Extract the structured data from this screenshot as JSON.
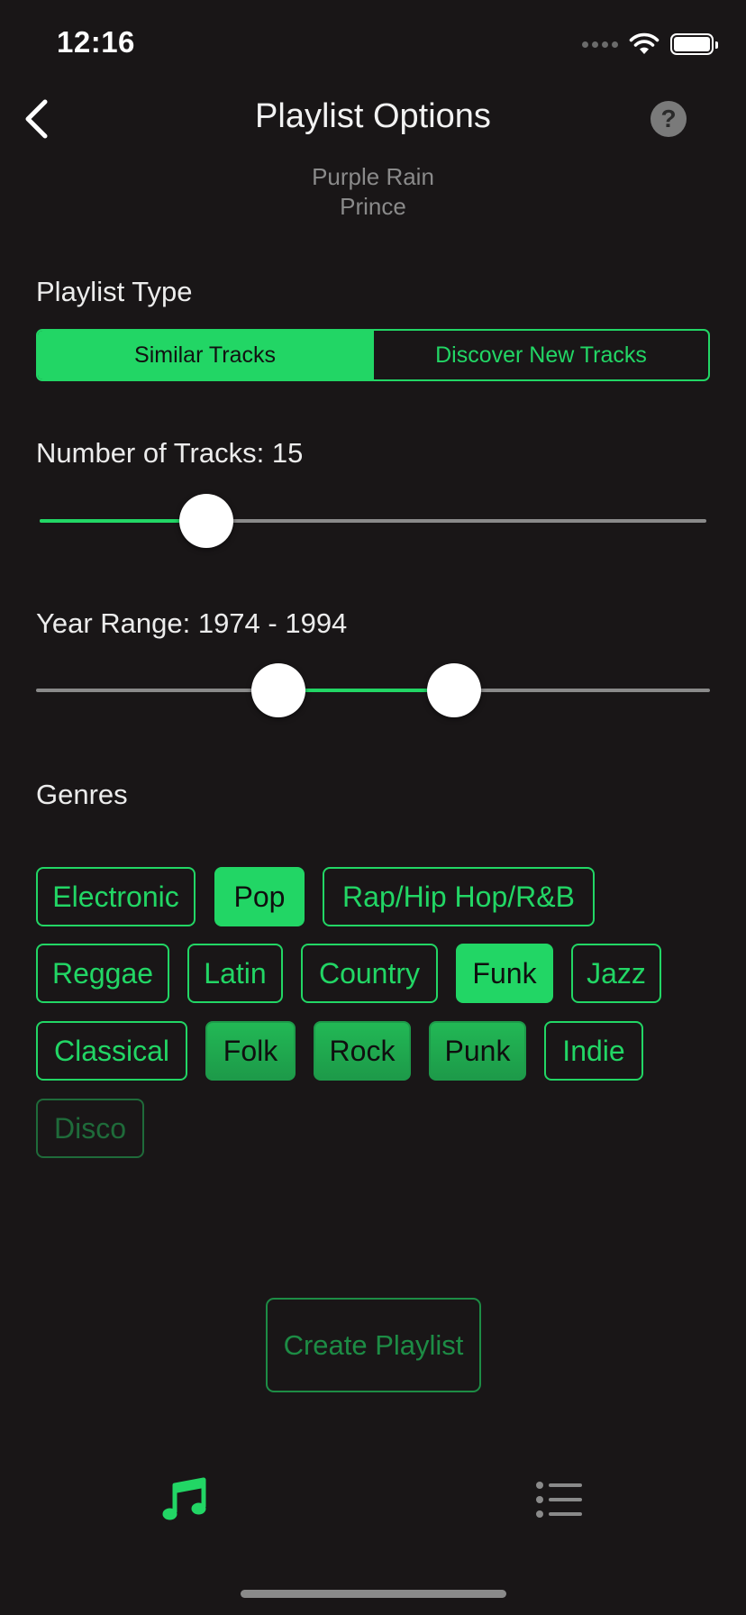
{
  "status_bar": {
    "time": "12:16"
  },
  "nav": {
    "title": "Playlist Options",
    "help_label": "?"
  },
  "song": {
    "title": "Purple Rain",
    "artist": "Prince"
  },
  "playlist_type": {
    "label": "Playlist Type",
    "options": [
      "Similar Tracks",
      "Discover New Tracks"
    ],
    "selected": "Similar Tracks"
  },
  "tracks": {
    "label": "Number of Tracks: 15",
    "value": 15,
    "fraction": 0.25
  },
  "year_range": {
    "label": "Year Range: 1974 - 1994",
    "start": 1974,
    "end": 1994,
    "start_fraction": 0.36,
    "end_fraction": 0.62
  },
  "genres": {
    "label": "Genres",
    "items": [
      {
        "name": "Electronic",
        "state": "unselected"
      },
      {
        "name": "Pop",
        "state": "selected"
      },
      {
        "name": "Rap/Hip Hop/R&B",
        "state": "unselected"
      },
      {
        "name": "Reggae",
        "state": "unselected"
      },
      {
        "name": "Latin",
        "state": "unselected"
      },
      {
        "name": "Country",
        "state": "unselected"
      },
      {
        "name": "Funk",
        "state": "selected"
      },
      {
        "name": "Jazz",
        "state": "unselected"
      },
      {
        "name": "Classical",
        "state": "unselected"
      },
      {
        "name": "Folk",
        "state": "selected"
      },
      {
        "name": "Rock",
        "state": "selected"
      },
      {
        "name": "Punk",
        "state": "selected"
      },
      {
        "name": "Indie",
        "state": "unselected"
      },
      {
        "name": "Disco",
        "state": "unselected"
      }
    ]
  },
  "create_button": {
    "label": "Create Playlist"
  },
  "tab_bar": {
    "tabs": [
      "music-note-icon",
      "list-icon"
    ],
    "active": "music-note-icon"
  },
  "colors": {
    "accent": "#22d665",
    "background": "#191617"
  }
}
